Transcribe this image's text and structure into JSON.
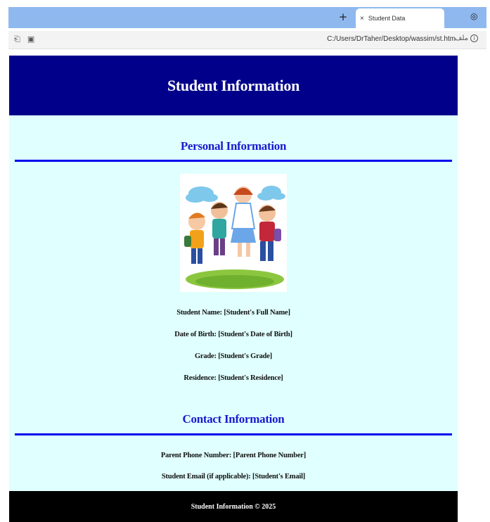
{
  "browser": {
    "tab_title": "Student Data",
    "tab_close": "×",
    "new_tab": "+",
    "url": "C:/Users/DrTaher/Desktop/wassim/st.htm",
    "file_label": "ملف"
  },
  "page": {
    "header_title": "Student Information",
    "personal": {
      "title": "Personal Information",
      "lines": [
        "Student Name: [Student's Full Name]",
        "Date of Birth: [Student's Date of Birth]",
        "Grade: [Student's Grade]",
        "Residence: [Student's Residence]"
      ]
    },
    "contact": {
      "title": "Contact Information",
      "lines": [
        "Parent Phone Number: [Parent Phone Number]",
        "Student Email (if applicable): [Student's Email]"
      ]
    },
    "footer": "Student Information © 2025"
  },
  "colors": {
    "header_bg": "#00008b",
    "page_bg": "#e0ffff",
    "section_title": "#1a1ad0",
    "rule": "#0000ee",
    "footer_bg": "#000000"
  }
}
